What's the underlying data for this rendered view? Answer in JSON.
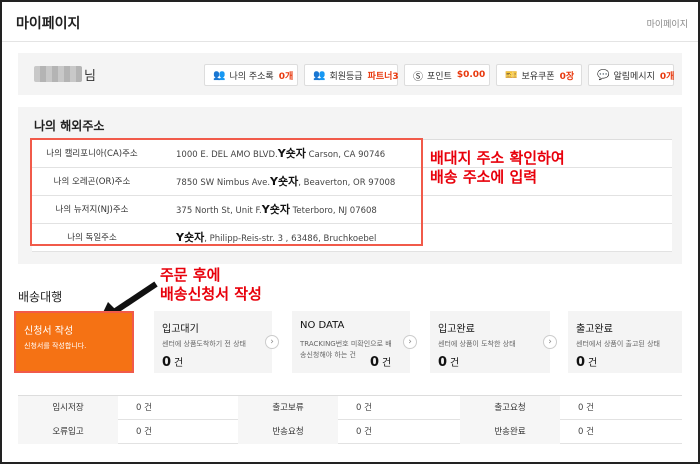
{
  "header": {
    "title": "마이페이지",
    "breadcrumb": "마이페이지"
  },
  "greeting": {
    "suffix": "님"
  },
  "stats": [
    {
      "icon": "address-book-icon",
      "glyph": "👥",
      "label": "나의 주소록",
      "value": "0개"
    },
    {
      "icon": "member-grade-icon",
      "glyph": "👥",
      "label": "회원등급",
      "value": "파트너3"
    },
    {
      "icon": "points-icon",
      "glyph": "Ⓢ",
      "label": "포인트",
      "value": "$0.00"
    },
    {
      "icon": "coupon-icon",
      "glyph": "🎫",
      "label": "보유쿠폰",
      "value": "0장"
    },
    {
      "icon": "message-icon",
      "glyph": "💬",
      "label": "알림메시지",
      "value": "0개"
    }
  ],
  "overseas": {
    "title": "나의 해외주소",
    "rows": [
      {
        "label": "나의 캘리포니아(CA)주소",
        "pre": "1000 E. DEL AMO BLVD.",
        "name": "Y숏자",
        "post": "  Carson, CA   90746"
      },
      {
        "label": "나의 오레곤(OR)주소",
        "pre": "7850 SW Nimbus Ave.",
        "name": "Y숏자",
        "post": ", Beaverton, OR   97008"
      },
      {
        "label": "나의 뉴저지(NJ)주소",
        "pre": "375 North St, Unit F.",
        "name": "Y숏자",
        "post": "  Teterboro, NJ   07608"
      },
      {
        "label": "나의 독일주소",
        "pre": "",
        "name": "Y숏자",
        "post": ", Philipp-Reis-str. 3 , 63486, Bruchkoebel"
      }
    ]
  },
  "annotations": {
    "address_note_line1": "배대지 주소 확인하여",
    "address_note_line2": "배송 주소에 입력",
    "order_note_line1": "주문 후에",
    "order_note_line2": "배송신청서 작성"
  },
  "shipping": {
    "title": "배송대행",
    "steps": [
      {
        "title": "신청서 작성",
        "desc1": "신청서를 작성합니다.",
        "desc2": "",
        "count": "",
        "unit": ""
      },
      {
        "title": "입고대기",
        "desc1": "센터에 상품도착하기 전 상태",
        "desc2": "",
        "count": "0",
        "unit": "건"
      },
      {
        "title": "NO DATA",
        "desc1": "TRACKING번호 미확인으로 배",
        "desc2": "송신청해야 하는 건",
        "count": "0",
        "unit": "건"
      },
      {
        "title": "입고완료",
        "desc1": "센터에 상품이 도착한 상태",
        "desc2": "",
        "count": "0",
        "unit": "건"
      },
      {
        "title": "출고완료",
        "desc1": "센터에서 상품이 출고된 상태",
        "desc2": "",
        "count": "0",
        "unit": "건"
      }
    ]
  },
  "status": {
    "rows": [
      [
        {
          "label": "임시저장",
          "value": "0 건"
        },
        {
          "label": "출고보류",
          "value": "0 건"
        },
        {
          "label": "출고요청",
          "value": "0 건"
        }
      ],
      [
        {
          "label": "오류입고",
          "value": "0 건"
        },
        {
          "label": "반송요청",
          "value": "0 건"
        },
        {
          "label": "반송완료",
          "value": "0 건"
        }
      ]
    ]
  },
  "colors": {
    "accent": "#f57214",
    "value_red": "#e8380d",
    "annotation_red": "#e8000b",
    "panel_gray": "#f4f4f4"
  }
}
